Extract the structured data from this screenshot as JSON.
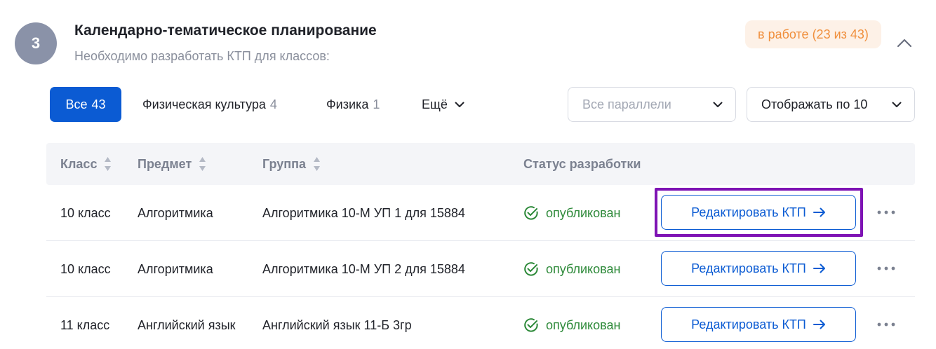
{
  "section": {
    "step_number": "3",
    "title": "Календарно-тематическое планирование",
    "subtitle": "Необходимо разработать КТП для классов:",
    "status_badge": "в работе (23 из 43)"
  },
  "tabs": [
    {
      "label": "Все",
      "count": "43"
    },
    {
      "label": "Физическая культура",
      "count": "4"
    },
    {
      "label": "Физика",
      "count": "1"
    },
    {
      "label": "Ещё"
    }
  ],
  "filters": {
    "parallels_placeholder": "Все параллели",
    "per_page_label": "Отображать по 10"
  },
  "table": {
    "headers": {
      "class": "Класс",
      "subject": "Предмет",
      "group": "Группа",
      "status": "Статус разработки"
    },
    "rows": [
      {
        "class": "10 класс",
        "subject": "Алгоритмика",
        "group": "Алгоритмика 10-М УП 1 для 15884",
        "status": "опубликован",
        "action": "Редактировать КТП"
      },
      {
        "class": "10 класс",
        "subject": "Алгоритмика",
        "group": "Алгоритмика 10-М УП 2 для 15884",
        "status": "опубликован",
        "action": "Редактировать КТП"
      },
      {
        "class": "11 класс",
        "subject": "Английский язык",
        "group": "Английский язык 11-Б 3гр",
        "status": "опубликован",
        "action": "Редактировать КТП"
      }
    ]
  },
  "colors": {
    "accent": "#0b5bd3",
    "status_published": "#2e8a3a",
    "badge_text": "#f08f3c",
    "badge_bg": "#fdf1e7",
    "highlight": "#7e13b4"
  },
  "icons": {
    "collapse": "chevron-up-icon",
    "dropdown": "chevron-down-icon",
    "sort": "sort-icon",
    "status": "check-circle-icon",
    "action": "arrow-right-icon",
    "more": "more-horizontal-icon"
  }
}
